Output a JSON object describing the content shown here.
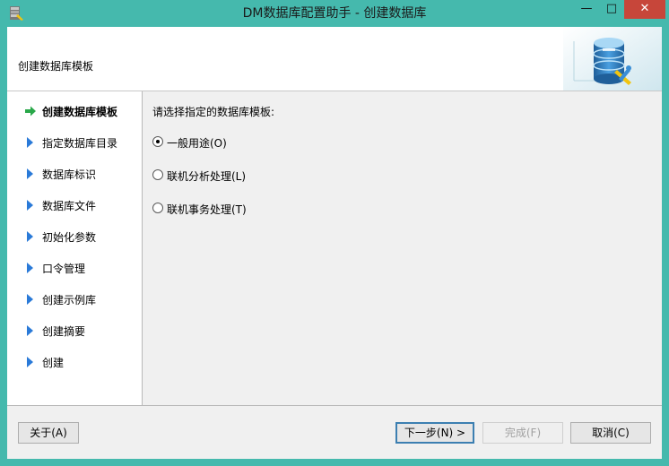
{
  "window": {
    "title": "DM数据库配置助手 - 创建数据库",
    "controls": {
      "minimize": "—",
      "maximize": "□",
      "close": "✕"
    }
  },
  "header": {
    "title": "创建数据库模板"
  },
  "nav": {
    "items": [
      {
        "label": "创建数据库模板",
        "active": true
      },
      {
        "label": "指定数据库目录"
      },
      {
        "label": "数据库标识"
      },
      {
        "label": "数据库文件"
      },
      {
        "label": "初始化参数"
      },
      {
        "label": "口令管理"
      },
      {
        "label": "创建示例库"
      },
      {
        "label": "创建摘要"
      },
      {
        "label": "创建"
      }
    ]
  },
  "content": {
    "prompt": "请选择指定的数据库模板:",
    "options": [
      {
        "label": "一般用途(O)",
        "checked": true
      },
      {
        "label": "联机分析处理(L)",
        "checked": false
      },
      {
        "label": "联机事务处理(T)",
        "checked": false
      }
    ]
  },
  "buttons": {
    "about": "关于(A)",
    "next": "下一步(N) >",
    "finish": "完成(F)",
    "cancel": "取消(C)"
  },
  "colors": {
    "accent": "#2a7ad8",
    "active_arrow": "#2aa84a",
    "frame": "#45b9ad",
    "close": "#c7463a"
  }
}
